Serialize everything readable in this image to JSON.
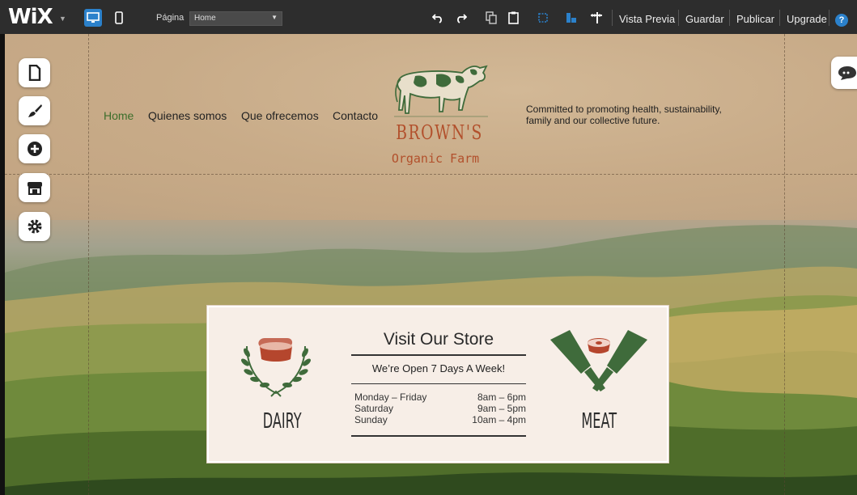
{
  "toolbar": {
    "logo": "WiX",
    "page_label": "Página",
    "page_select_value": "Home",
    "preview": "Vista Previa",
    "save": "Guardar",
    "publish": "Publicar",
    "upgrade": "Upgrade",
    "help": "?",
    "accent_color": "#2b81cb"
  },
  "left_rail": [
    "pages-icon",
    "design-icon",
    "add-icon",
    "store-icon",
    "settings-icon"
  ],
  "site": {
    "nav": [
      "Home",
      "Quienes somos",
      "Que ofrecemos",
      "Contacto"
    ],
    "logo_line1": "BROWN'S",
    "logo_line2": "Organic Farm",
    "tagline": "Committed to promoting health, sustainability, family and our collective future.",
    "store": {
      "title": "Visit Our Store",
      "subtitle": "We’re Open 7 Days A Week!",
      "hours": [
        {
          "days": "Monday – Friday",
          "time": "8am – 6pm"
        },
        {
          "days": "Saturday",
          "time": "9am – 5pm"
        },
        {
          "days": "Sunday",
          "time": "10am – 4pm"
        }
      ],
      "left_category": "DAIRY",
      "right_category": "MEAT"
    },
    "colors": {
      "nav_active": "#3c6e2b",
      "logo": "#b2502c",
      "icon_green": "#3f6b3b",
      "icon_red": "#b5462d"
    }
  }
}
